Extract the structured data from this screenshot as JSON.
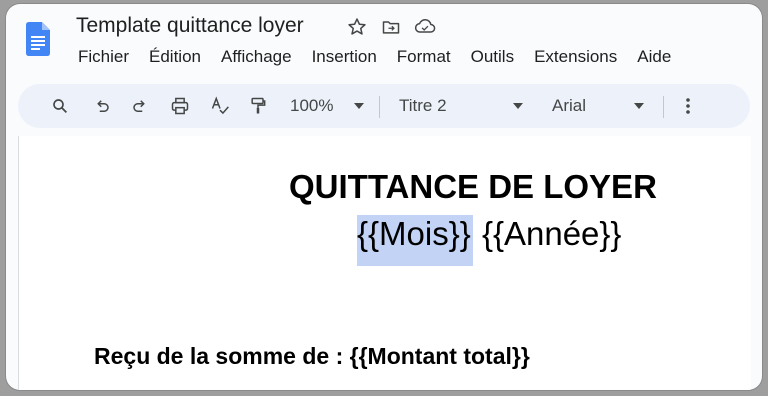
{
  "app": {
    "title": "Template quittance loyer"
  },
  "menu": [
    "Fichier",
    "Édition",
    "Affichage",
    "Insertion",
    "Format",
    "Outils",
    "Extensions",
    "Aide"
  ],
  "toolbar": {
    "zoom": "100%",
    "style": "Titre 2",
    "font": "Arial"
  },
  "document": {
    "title": "QUITTANCE DE LOYER",
    "month_placeholder": "{{Mois}}",
    "year_placeholder": "{{Année}}",
    "body_line": "Reçu de la somme de : {{Montant total}}"
  },
  "colors": {
    "accent": "#4285f4",
    "toolbar_bg": "#edf2fa",
    "selection": "#c3d3f5"
  }
}
